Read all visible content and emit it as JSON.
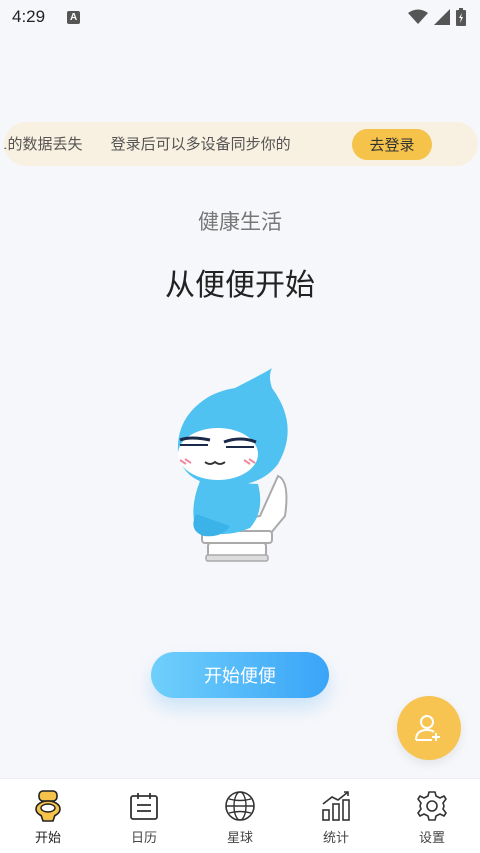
{
  "status_bar": {
    "time": "4:29",
    "notification_letter": "A"
  },
  "banner": {
    "segments": [
      "‎的数据丢失",
      "登录后可以多设备同步你的"
    ],
    "lead_fragment": "1",
    "login_label": "去登录"
  },
  "hero": {
    "subtitle": "健康生活",
    "title": "从便便开始"
  },
  "start_button": {
    "label": "开始便便"
  },
  "fab": {
    "icon": "add-user-icon"
  },
  "nav": {
    "items": [
      {
        "label": "开始",
        "icon": "toilet-icon",
        "active": true
      },
      {
        "label": "日历",
        "icon": "calendar-icon",
        "active": false
      },
      {
        "label": "星球",
        "icon": "globe-icon",
        "active": false
      },
      {
        "label": "统计",
        "icon": "chart-icon",
        "active": false
      },
      {
        "label": "设置",
        "icon": "gear-icon",
        "active": false
      }
    ]
  },
  "colors": {
    "accent_yellow": "#f5c24a",
    "button_blue_start": "#6fd0fb",
    "button_blue_end": "#3aa4f7",
    "banner_bg": "#f8f1e1",
    "background": "#f6f7fb"
  }
}
